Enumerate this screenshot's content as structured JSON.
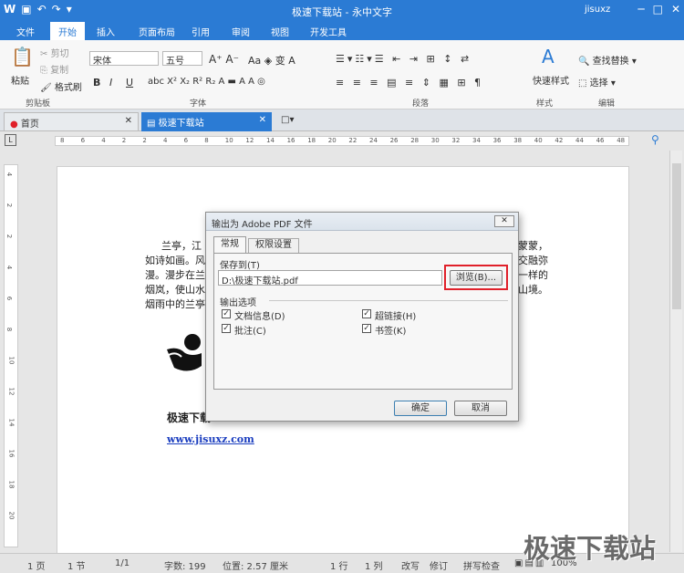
{
  "app": {
    "title": "极速下载站 - 永中文字",
    "user": "jisuxz"
  },
  "menu": [
    "文件",
    "开始",
    "插入",
    "页面布局",
    "引用",
    "审阅",
    "视图",
    "开发工具"
  ],
  "ribbon": {
    "paste": "粘贴",
    "cut": "剪切",
    "copy": "复制",
    "format_painter": "格式刷",
    "clipboard_group": "剪贴板",
    "font_group": "字体",
    "paragraph_group": "段落",
    "style_group": "样式",
    "edit_group": "编辑",
    "font_name": "宋体",
    "font_size": "五号",
    "quick_style": "快速样式",
    "find_replace": "查找替换",
    "select": "选择",
    "bold": "B",
    "italic": "I",
    "underline": "U"
  },
  "doc_tabs": {
    "home": "首页",
    "doc": "极速下载站"
  },
  "ruler_h": [
    "8",
    "6",
    "4",
    "2",
    "2",
    "4",
    "6",
    "8",
    "10",
    "12",
    "14",
    "16",
    "18",
    "20",
    "22",
    "24",
    "26",
    "28",
    "30",
    "32",
    "34",
    "36",
    "38",
    "40",
    "42",
    "44",
    "46",
    "48"
  ],
  "ruler_v": [
    "4",
    "2",
    "2",
    "4",
    "6",
    "8",
    "10",
    "12",
    "14",
    "16",
    "18",
    "20"
  ],
  "document": {
    "line1_start": "兰亭，江",
    "line1_end": "蒙蒙，",
    "line2_start": "如诗如画。风",
    "line2_end": "交融弥",
    "line3_start": "漫。漫步在兰",
    "line3_end": "一样的",
    "line4_start": "烟岚，使山水",
    "line4_end": "山境。",
    "line5_start": "烟雨中的兰亭",
    "heading": "极速下载",
    "link": "www.jisuxz.com"
  },
  "dialog": {
    "title": "输出为 Adobe PDF 文件",
    "tab_general": "常规",
    "tab_permissions": "权限设置",
    "save_to_label": "保存到(T)",
    "path": "D:\\极速下载站.pdf",
    "browse": "浏览(B)...",
    "options_label": "输出选项",
    "opt_docinfo": "文档信息(D)",
    "opt_hyperlink": "超链接(H)",
    "opt_comments": "批注(C)",
    "opt_bookmarks": "书签(K)",
    "ok": "确定",
    "cancel": "取消"
  },
  "status": {
    "page": "1 页",
    "section": "1 节",
    "pages": "1/1",
    "words": "字数: 199",
    "position": "位置: 2.57 厘米",
    "line": "1 行",
    "col": "1 列",
    "overwrite": "改写",
    "revise": "修订",
    "spellcheck": "拼写检查",
    "zoom": "100%"
  },
  "watermark": "极速下载站",
  "colors": {
    "accent": "#2b7bd4",
    "highlight_red": "#e0202a"
  }
}
